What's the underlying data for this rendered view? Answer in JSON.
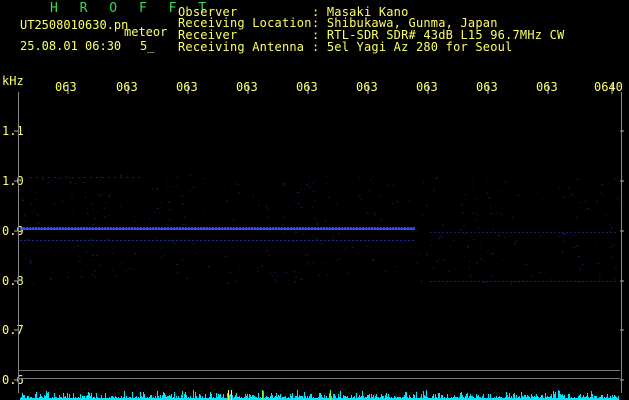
{
  "app": {
    "title": "H R O F F T"
  },
  "file": {
    "name": "UT2508010630.pn",
    "datetime": "25.08.01 06:30",
    "counter": "5_"
  },
  "mode": {
    "label": "meteor"
  },
  "info": {
    "rows": [
      {
        "label": "Observer",
        "value": ": Masaki Kano"
      },
      {
        "label": "Receiving Location",
        "value": ": Shibukawa, Gunma, Japan"
      },
      {
        "label": "Receiver",
        "value": ": RTL-SDR SDR# 43dB L15 96.7MHz CW"
      },
      {
        "label": "Receiving Antenna",
        "value": ": 5el Yagi Az 280 for Seoul"
      }
    ]
  },
  "axis": {
    "y_unit": "kHz",
    "y_labels": [
      "1.1",
      "1.0",
      "0.9",
      "0.8",
      "0.7",
      "0.6"
    ],
    "x_labels": [
      "063",
      "063",
      "063",
      "063",
      "063",
      "063",
      "063",
      "063",
      "063",
      "0640"
    ]
  },
  "colors": {
    "trace": "#3a4cff",
    "signal": "#00e5ff",
    "text": "#ffff66",
    "brand": "#33dd55"
  }
}
